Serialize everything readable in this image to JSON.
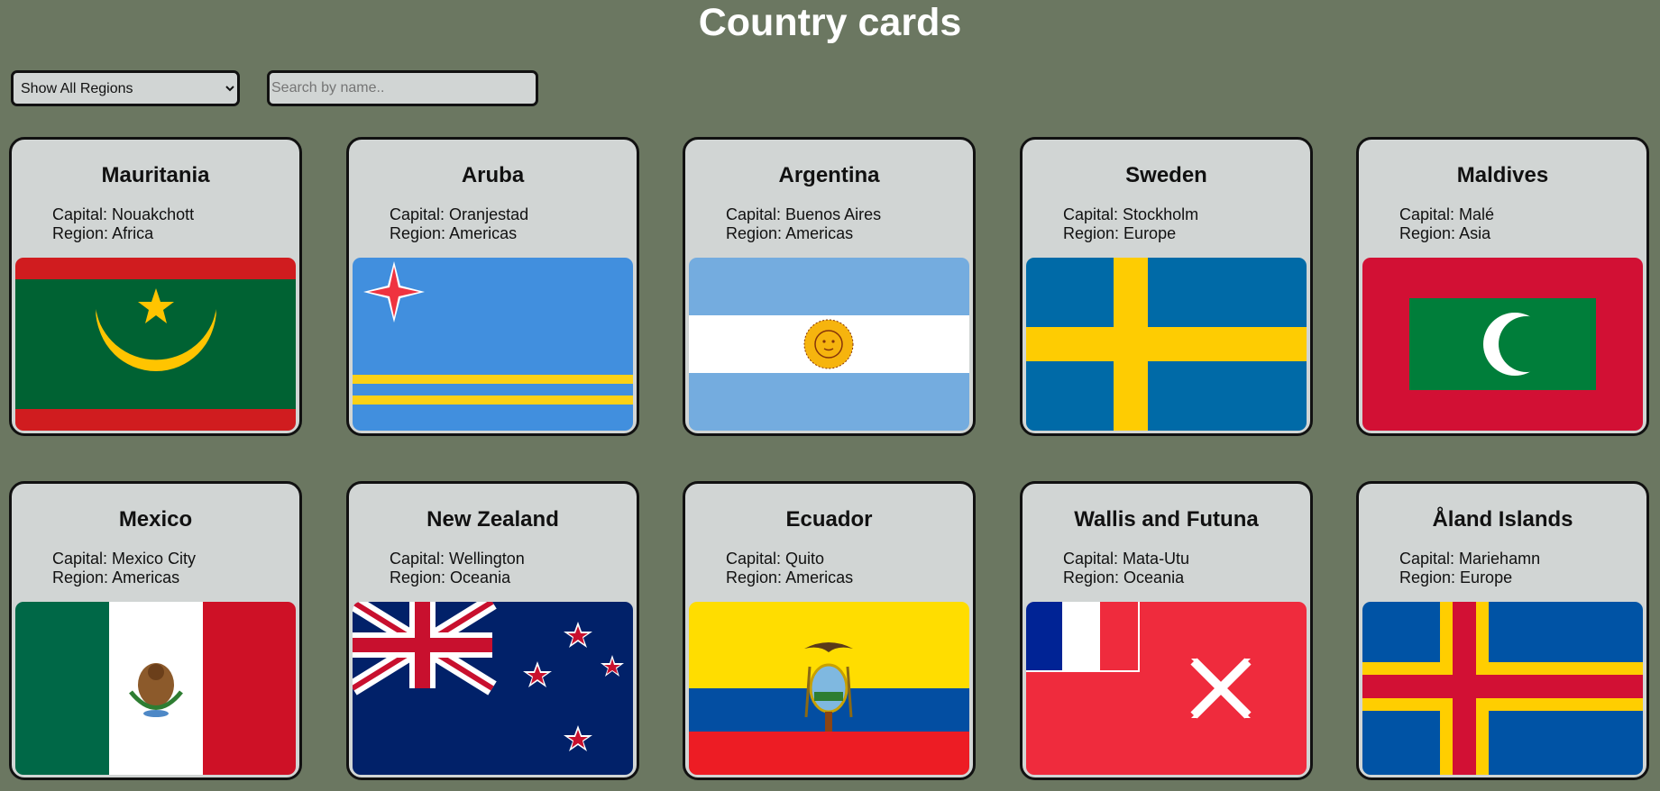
{
  "page": {
    "title": "Country cards"
  },
  "filters": {
    "region_select": {
      "selected": "Show All Regions",
      "options": [
        "Show All Regions"
      ]
    },
    "search": {
      "placeholder": "Search by name..",
      "value": ""
    }
  },
  "labels": {
    "capital_prefix": "Capital: ",
    "region_prefix": "Region: "
  },
  "countries": [
    {
      "name": "Mauritania",
      "capital": "Nouakchott",
      "region": "Africa",
      "flag_icon": "mauritania-flag-icon"
    },
    {
      "name": "Aruba",
      "capital": "Oranjestad",
      "region": "Americas",
      "flag_icon": "aruba-flag-icon"
    },
    {
      "name": "Argentina",
      "capital": "Buenos Aires",
      "region": "Americas",
      "flag_icon": "argentina-flag-icon"
    },
    {
      "name": "Sweden",
      "capital": "Stockholm",
      "region": "Europe",
      "flag_icon": "sweden-flag-icon"
    },
    {
      "name": "Maldives",
      "capital": "Malé",
      "region": "Asia",
      "flag_icon": "maldives-flag-icon"
    },
    {
      "name": "Mexico",
      "capital": "Mexico City",
      "region": "Americas",
      "flag_icon": "mexico-flag-icon"
    },
    {
      "name": "New Zealand",
      "capital": "Wellington",
      "region": "Oceania",
      "flag_icon": "new-zealand-flag-icon"
    },
    {
      "name": "Ecuador",
      "capital": "Quito",
      "region": "Americas",
      "flag_icon": "ecuador-flag-icon"
    },
    {
      "name": "Wallis and Futuna",
      "capital": "Mata-Utu",
      "region": "Oceania",
      "flag_icon": "wallis-and-futuna-flag-icon"
    },
    {
      "name": "Åland Islands",
      "capital": "Mariehamn",
      "region": "Europe",
      "flag_icon": "aland-islands-flag-icon"
    }
  ],
  "colors": {
    "background": "#6b7761",
    "card": "#d1d5d4",
    "border": "#111111",
    "title": "#ffffff"
  }
}
